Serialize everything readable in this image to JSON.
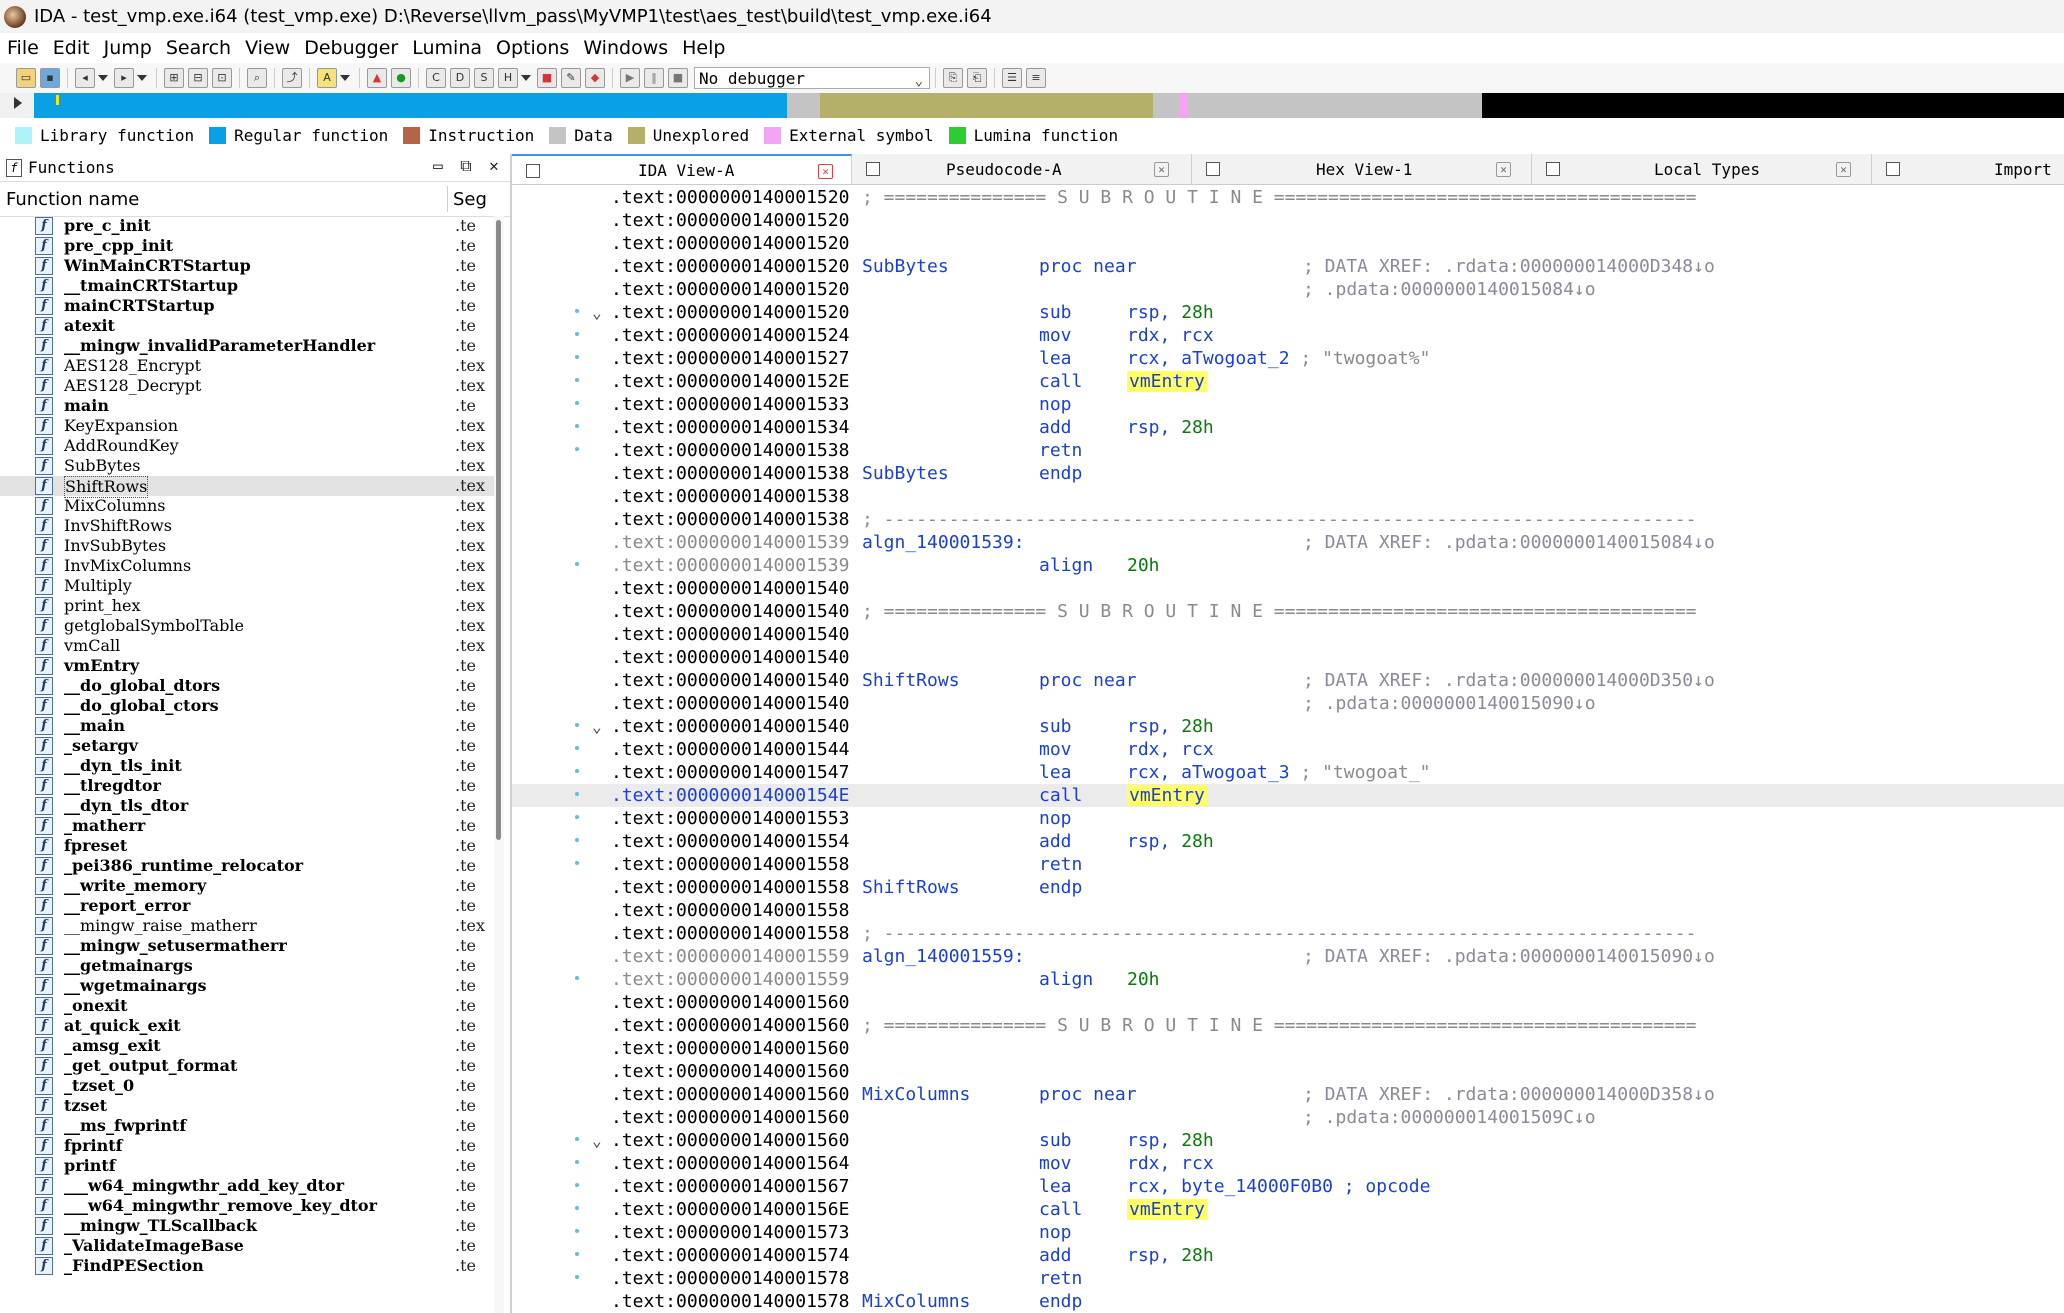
{
  "title": "IDA - test_vmp.exe.i64 (test_vmp.exe) D:\\Reverse\\llvm_pass\\MyVMP1\\test\\aes_test\\build\\test_vmp.exe.i64",
  "menu": [
    "File",
    "Edit",
    "Jump",
    "Search",
    "View",
    "Debugger",
    "Lumina",
    "Options",
    "Windows",
    "Help"
  ],
  "toolbar": {
    "debugger": "No debugger"
  },
  "colors": {
    "library": "#aef3fb",
    "regular": "#0aa0e6",
    "instruction": "#b5644a",
    "data": "#c4c4c4",
    "unexplored": "#b4b06a",
    "external": "#f4a4f4",
    "lumina": "#2ecc2e",
    "nav_black": "#000000"
  },
  "legend": [
    {
      "label": "Library function",
      "color": "#aef3fb"
    },
    {
      "label": "Regular function",
      "color": "#0aa0e6"
    },
    {
      "label": "Instruction",
      "color": "#b5644a"
    },
    {
      "label": "Data",
      "color": "#c4c4c4"
    },
    {
      "label": "Unexplored",
      "color": "#b4b06a"
    },
    {
      "label": "External symbol",
      "color": "#f4a4f4"
    },
    {
      "label": "Lumina function",
      "color": "#2ecc2e"
    }
  ],
  "functions_pane": {
    "title": "Functions",
    "col_name": "Function name",
    "col_seg": "Seg",
    "items": [
      {
        "name": "pre_c_init",
        "seg": ".te",
        "bold": true
      },
      {
        "name": "pre_cpp_init",
        "seg": ".te",
        "bold": true
      },
      {
        "name": "WinMainCRTStartup",
        "seg": ".te",
        "bold": true
      },
      {
        "name": "__tmainCRTStartup",
        "seg": ".te",
        "bold": true
      },
      {
        "name": "mainCRTStartup",
        "seg": ".te",
        "bold": true
      },
      {
        "name": "atexit",
        "seg": ".te",
        "bold": true
      },
      {
        "name": "__mingw_invalidParameterHandler",
        "seg": ".te",
        "bold": true
      },
      {
        "name": "AES128_Encrypt",
        "seg": ".tex",
        "bold": false
      },
      {
        "name": "AES128_Decrypt",
        "seg": ".tex",
        "bold": false
      },
      {
        "name": "main",
        "seg": ".te",
        "bold": true
      },
      {
        "name": "KeyExpansion",
        "seg": ".tex",
        "bold": false
      },
      {
        "name": "AddRoundKey",
        "seg": ".tex",
        "bold": false
      },
      {
        "name": "SubBytes",
        "seg": ".tex",
        "bold": false
      },
      {
        "name": "ShiftRows",
        "seg": ".tex",
        "bold": false,
        "selected": true
      },
      {
        "name": "MixColumns",
        "seg": ".tex",
        "bold": false
      },
      {
        "name": "InvShiftRows",
        "seg": ".tex",
        "bold": false
      },
      {
        "name": "InvSubBytes",
        "seg": ".tex",
        "bold": false
      },
      {
        "name": "InvMixColumns",
        "seg": ".tex",
        "bold": false
      },
      {
        "name": "Multiply",
        "seg": ".tex",
        "bold": false
      },
      {
        "name": "print_hex",
        "seg": ".tex",
        "bold": false
      },
      {
        "name": "getglobalSymbolTable",
        "seg": ".tex",
        "bold": false
      },
      {
        "name": "vmCall",
        "seg": ".tex",
        "bold": false
      },
      {
        "name": "vmEntry",
        "seg": ".te",
        "bold": true
      },
      {
        "name": "__do_global_dtors",
        "seg": ".te",
        "bold": true
      },
      {
        "name": "__do_global_ctors",
        "seg": ".te",
        "bold": true
      },
      {
        "name": "__main",
        "seg": ".te",
        "bold": true
      },
      {
        "name": "_setargv",
        "seg": ".te",
        "bold": true
      },
      {
        "name": "__dyn_tls_init",
        "seg": ".te",
        "bold": true
      },
      {
        "name": "__tlregdtor",
        "seg": ".te",
        "bold": true
      },
      {
        "name": "__dyn_tls_dtor",
        "seg": ".te",
        "bold": true
      },
      {
        "name": "_matherr",
        "seg": ".te",
        "bold": true
      },
      {
        "name": "fpreset",
        "seg": ".te",
        "bold": true
      },
      {
        "name": "_pei386_runtime_relocator",
        "seg": ".te",
        "bold": true
      },
      {
        "name": "__write_memory",
        "seg": ".te",
        "bold": true
      },
      {
        "name": "__report_error",
        "seg": ".te",
        "bold": true
      },
      {
        "name": "__mingw_raise_matherr",
        "seg": ".tex",
        "bold": false
      },
      {
        "name": "__mingw_setusermatherr",
        "seg": ".te",
        "bold": true
      },
      {
        "name": "__getmainargs",
        "seg": ".te",
        "bold": true
      },
      {
        "name": "__wgetmainargs",
        "seg": ".te",
        "bold": true
      },
      {
        "name": "_onexit",
        "seg": ".te",
        "bold": true
      },
      {
        "name": "at_quick_exit",
        "seg": ".te",
        "bold": true
      },
      {
        "name": "_amsg_exit",
        "seg": ".te",
        "bold": true
      },
      {
        "name": "_get_output_format",
        "seg": ".te",
        "bold": true
      },
      {
        "name": "_tzset_0",
        "seg": ".te",
        "bold": true
      },
      {
        "name": "tzset",
        "seg": ".te",
        "bold": true
      },
      {
        "name": "__ms_fwprintf",
        "seg": ".te",
        "bold": true
      },
      {
        "name": "fprintf",
        "seg": ".te",
        "bold": true
      },
      {
        "name": "printf",
        "seg": ".te",
        "bold": true
      },
      {
        "name": "___w64_mingwthr_add_key_dtor",
        "seg": ".te",
        "bold": true
      },
      {
        "name": "___w64_mingwthr_remove_key_dtor",
        "seg": ".te",
        "bold": true
      },
      {
        "name": "__mingw_TLScallback",
        "seg": ".te",
        "bold": true
      },
      {
        "name": "_ValidateImageBase",
        "seg": ".te",
        "bold": true
      },
      {
        "name": "_FindPESection",
        "seg": ".te",
        "bold": true
      }
    ]
  },
  "tabs": [
    {
      "label": "IDA View-A",
      "active": true
    },
    {
      "label": "Pseudocode-A",
      "active": false
    },
    {
      "label": "Hex View-1",
      "active": false
    },
    {
      "label": "Local Types",
      "active": false
    },
    {
      "label": "Import",
      "active": false
    }
  ],
  "disasm": [
    {
      "addr": ".text:0000000140001520",
      "dot": false,
      "kind": "sub",
      "text": "; =============== S U B R O U T I N E ======================================="
    },
    {
      "addr": ".text:0000000140001520"
    },
    {
      "addr": ".text:0000000140001520"
    },
    {
      "addr": ".text:0000000140001520",
      "label": "SubBytes",
      "mn": "proc near",
      "xref": "; DATA XREF: .rdata:000000014000D348↓o"
    },
    {
      "addr": ".text:0000000140001520",
      "xref": "; .pdata:0000000140015084↓o"
    },
    {
      "addr": ".text:0000000140001520",
      "dot": true,
      "chev": true,
      "mn": "sub",
      "ops": "rsp, ",
      "num": "28h"
    },
    {
      "addr": ".text:0000000140001524",
      "dot": true,
      "mn": "mov",
      "ops": "rdx, rcx"
    },
    {
      "addr": ".text:0000000140001527",
      "dot": true,
      "mn": "lea",
      "ops": "rcx, aTwogoat_2 ",
      "cmt": "; \"twogoat%\""
    },
    {
      "addr": ".text:000000014000152E",
      "dot": true,
      "mn": "call",
      "vm": "vmEntry"
    },
    {
      "addr": ".text:0000000140001533",
      "dot": true,
      "mn": "nop"
    },
    {
      "addr": ".text:0000000140001534",
      "dot": true,
      "mn": "add",
      "ops": "rsp, ",
      "num": "28h"
    },
    {
      "addr": ".text:0000000140001538",
      "dot": true,
      "mn": "retn"
    },
    {
      "addr": ".text:0000000140001538",
      "label": "SubBytes",
      "mn": "endp"
    },
    {
      "addr": ".text:0000000140001538"
    },
    {
      "addr": ".text:0000000140001538",
      "kind": "dash",
      "text": "; ---------------------------------------------------------------------------"
    },
    {
      "addr": ".text:0000000140001539",
      "gray": true,
      "label": "algn_140001539:",
      "xref": "; DATA XREF: .pdata:0000000140015084↓o"
    },
    {
      "addr": ".text:0000000140001539",
      "gray": true,
      "dot": true,
      "mn": "align",
      "num": "20h",
      "numonly": true
    },
    {
      "addr": ".text:0000000140001540"
    },
    {
      "addr": ".text:0000000140001540",
      "kind": "sub",
      "text": "; =============== S U B R O U T I N E ======================================="
    },
    {
      "addr": ".text:0000000140001540"
    },
    {
      "addr": ".text:0000000140001540"
    },
    {
      "addr": ".text:0000000140001540",
      "label": "ShiftRows",
      "mn": "proc near",
      "xref": "; DATA XREF: .rdata:000000014000D350↓o"
    },
    {
      "addr": ".text:0000000140001540",
      "xref": "; .pdata:0000000140015090↓o"
    },
    {
      "addr": ".text:0000000140001540",
      "dot": true,
      "chev": true,
      "mn": "sub",
      "ops": "rsp, ",
      "num": "28h"
    },
    {
      "addr": ".text:0000000140001544",
      "dot": true,
      "mn": "mov",
      "ops": "rdx, rcx"
    },
    {
      "addr": ".text:0000000140001547",
      "dot": true,
      "mn": "lea",
      "ops": "rcx, aTwogoat_3 ",
      "cmt": "; \"twogoat_\""
    },
    {
      "addr": ".text:000000014000154E",
      "dot": true,
      "hl": true,
      "mn": "call",
      "vm": "vmEntry"
    },
    {
      "addr": ".text:0000000140001553",
      "dot": true,
      "mn": "nop"
    },
    {
      "addr": ".text:0000000140001554",
      "dot": true,
      "mn": "add",
      "ops": "rsp, ",
      "num": "28h"
    },
    {
      "addr": ".text:0000000140001558",
      "dot": true,
      "mn": "retn"
    },
    {
      "addr": ".text:0000000140001558",
      "label": "ShiftRows",
      "mn": "endp"
    },
    {
      "addr": ".text:0000000140001558"
    },
    {
      "addr": ".text:0000000140001558",
      "kind": "dash",
      "text": "; ---------------------------------------------------------------------------"
    },
    {
      "addr": ".text:0000000140001559",
      "gray": true,
      "label": "algn_140001559:",
      "xref": "; DATA XREF: .pdata:0000000140015090↓o"
    },
    {
      "addr": ".text:0000000140001559",
      "gray": true,
      "dot": true,
      "mn": "align",
      "num": "20h",
      "numonly": true
    },
    {
      "addr": ".text:0000000140001560"
    },
    {
      "addr": ".text:0000000140001560",
      "kind": "sub",
      "text": "; =============== S U B R O U T I N E ======================================="
    },
    {
      "addr": ".text:0000000140001560"
    },
    {
      "addr": ".text:0000000140001560"
    },
    {
      "addr": ".text:0000000140001560",
      "label": "MixColumns",
      "mn": "proc near",
      "xref": "; DATA XREF: .rdata:000000014000D358↓o"
    },
    {
      "addr": ".text:0000000140001560",
      "xref": "; .pdata:000000014001509C↓o"
    },
    {
      "addr": ".text:0000000140001560",
      "dot": true,
      "chev": true,
      "mn": "sub",
      "ops": "rsp, ",
      "num": "28h"
    },
    {
      "addr": ".text:0000000140001564",
      "dot": true,
      "mn": "mov",
      "ops": "rdx, rcx"
    },
    {
      "addr": ".text:0000000140001567",
      "dot": true,
      "mn": "lea",
      "ops": "rcx, byte_14000F0B0 ",
      "cmtblue": "; opcode"
    },
    {
      "addr": ".text:000000014000156E",
      "dot": true,
      "mn": "call",
      "vm": "vmEntry"
    },
    {
      "addr": ".text:0000000140001573",
      "dot": true,
      "mn": "nop"
    },
    {
      "addr": ".text:0000000140001574",
      "dot": true,
      "mn": "add",
      "ops": "rsp, ",
      "num": "28h"
    },
    {
      "addr": ".text:0000000140001578",
      "dot": true,
      "mn": "retn"
    },
    {
      "addr": ".text:0000000140001578",
      "label": "MixColumns",
      "mn": "endp"
    }
  ]
}
